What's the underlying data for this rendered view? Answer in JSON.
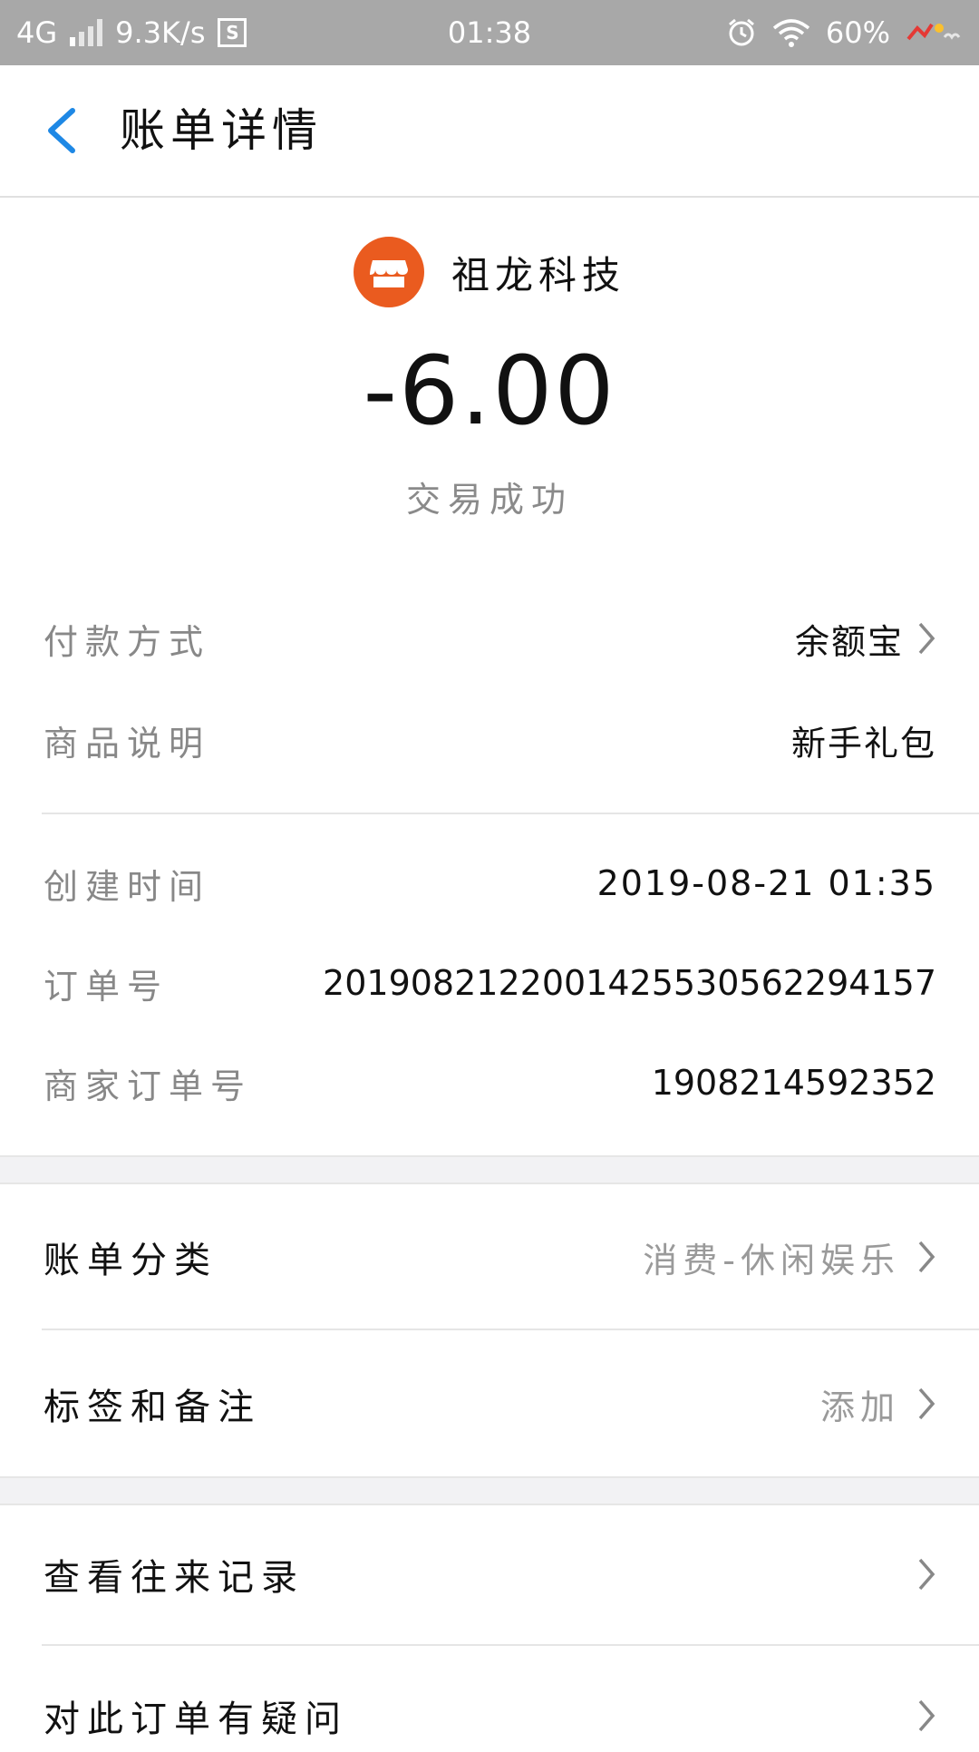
{
  "status_bar": {
    "network": "4G",
    "speed": "9.3K/s",
    "sim_badge": "S",
    "time": "01:38",
    "battery": "60%"
  },
  "header": {
    "title": "账单详情"
  },
  "merchant": {
    "name": "祖龙科技",
    "icon_color": "#ea5b1f"
  },
  "transaction": {
    "amount": "-6.00",
    "status": "交易成功"
  },
  "details": [
    {
      "label": "付款方式",
      "value": "余额宝"
    },
    {
      "label": "商品说明",
      "value": "新手礼包"
    },
    {
      "label": "创建时间",
      "value": "2019-08-21 01:35"
    },
    {
      "label": "订单号",
      "value": "2019082122001425530562294157"
    },
    {
      "label": "商家订单号",
      "value": "1908214592352"
    }
  ],
  "actions": [
    {
      "label": "账单分类",
      "value": "消费-休闲娱乐"
    },
    {
      "label": "标签和备注",
      "value": "添加"
    },
    {
      "label": "查看往来记录",
      "value": ""
    },
    {
      "label": "对此订单有疑问",
      "value": ""
    }
  ],
  "colors": {
    "accent_blue": "#1e88e5",
    "status_bar_bg": "#a8a8a8"
  }
}
